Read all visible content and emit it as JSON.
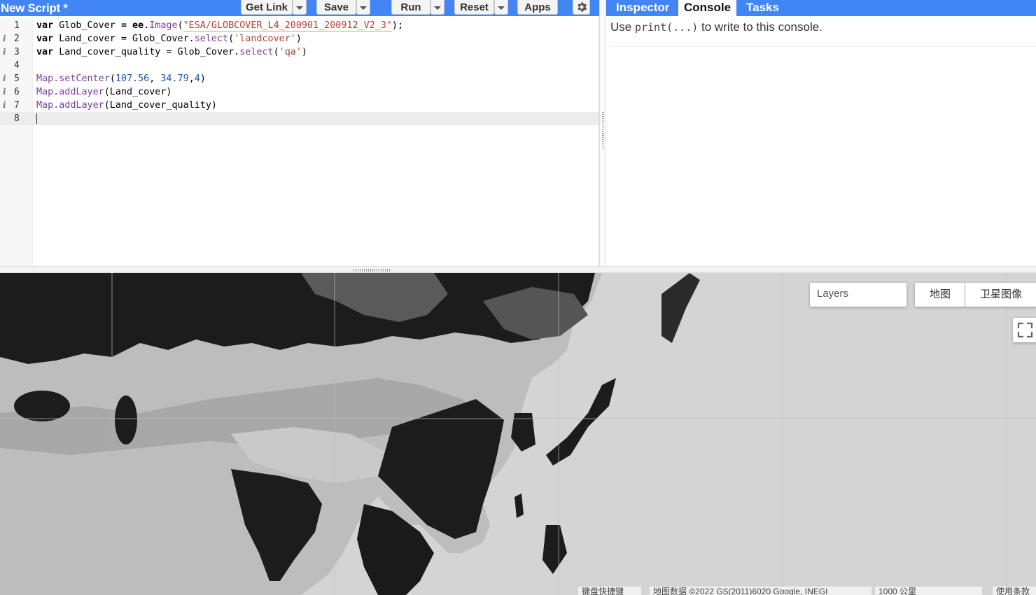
{
  "editor": {
    "title": "New Script *",
    "buttons": {
      "get_link": "Get Link",
      "save": "Save",
      "run": "Run",
      "reset": "Reset",
      "apps": "Apps"
    },
    "line_numbers": [
      "1",
      "2",
      "3",
      "4",
      "5",
      "6",
      "7",
      "8"
    ],
    "info_marker": "i",
    "code": {
      "l1": {
        "kw": "var",
        "a": " Glob_Cover ",
        "eq": "=",
        "b": " ee",
        "dot": ".",
        "fn": "Image",
        "open": "(",
        "str": "\"ESA/GLOBCOVER_L4_200901_200912_V2_3\"",
        "close": ");"
      },
      "l2": {
        "kw": "var",
        "a": " Land_cover = Glob_Cover.",
        "fn": "select",
        "open": "(",
        "str": "'landcover'",
        "close": ")"
      },
      "l3": {
        "kw": "var",
        "a": " Land_cover_quality = Glob_Cover.",
        "fn": "select",
        "open": "(",
        "str": "'qa'",
        "close": ")"
      },
      "l5": {
        "fn": "Map.setCenter",
        "open": "(",
        "n1": "107.56",
        "c1": ", ",
        "n2": "34.79",
        "c2": ",",
        "n3": "4",
        "close": ")"
      },
      "l6": {
        "fn": "Map.addLayer",
        "rest": "(Land_cover)"
      },
      "l7": {
        "fn": "Map.addLayer",
        "rest": "(Land_cover_quality)"
      }
    }
  },
  "right_panel": {
    "tabs": [
      "Inspector",
      "Console",
      "Tasks"
    ],
    "active_tab": "Console",
    "console_hint_pre": "Use ",
    "console_hint_code": "print(...)",
    "console_hint_post": " to write to this console."
  },
  "map": {
    "layers_label": "Layers",
    "map_type_buttons": [
      "地图",
      "卫星图像"
    ],
    "attribution": {
      "shortcuts": "键盘快捷键",
      "data": "地图数据 ©2022 GS(2011)6020 Google, INEGI",
      "scale": "1000 公里",
      "terms": "使用条款"
    },
    "colors": {
      "background": "#d1d1d1",
      "ocean": "#d4d4d4",
      "dark_land": "#1c1c1c",
      "mid_land": "#5a5a5a",
      "light_land": "#a8a8a8",
      "pale_land": "#bdbdbd"
    }
  },
  "colors": {
    "toolbar_blue": "#4285f4",
    "keyword": "#000000",
    "function": "#7a3e9d",
    "string": "#b0413e",
    "number": "#1a55b5"
  }
}
